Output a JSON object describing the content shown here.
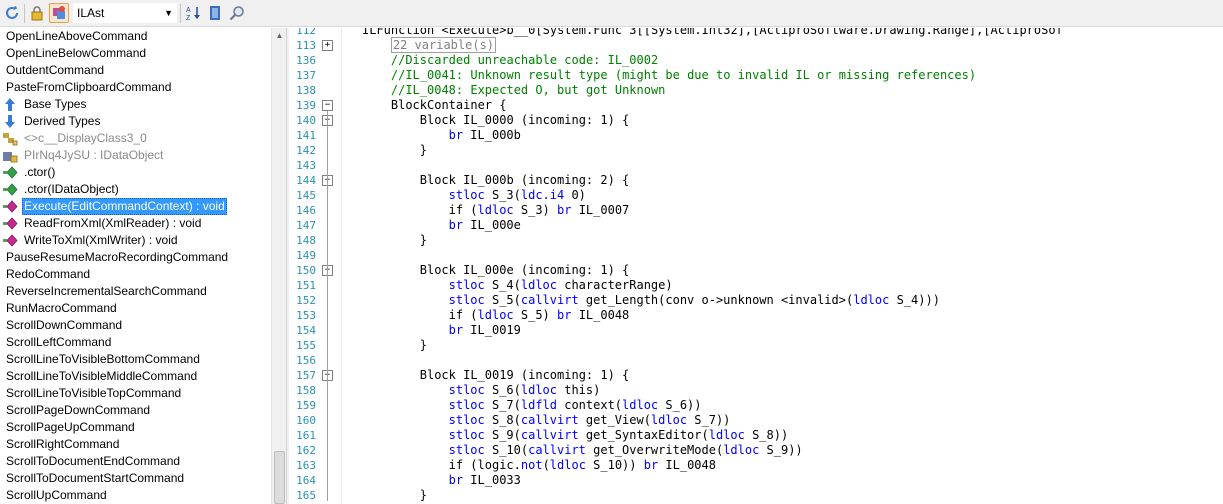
{
  "toolbar": {
    "language": "ILAst"
  },
  "tree": {
    "items": [
      {
        "label": "OpenLineAboveCommand",
        "icon": "",
        "indent": 0,
        "style": "normal"
      },
      {
        "label": "OpenLineBelowCommand",
        "icon": "",
        "indent": 0,
        "style": "normal"
      },
      {
        "label": "OutdentCommand",
        "icon": "",
        "indent": 0,
        "style": "normal"
      },
      {
        "label": "PasteFromClipboardCommand",
        "icon": "",
        "indent": 0,
        "style": "normal"
      },
      {
        "label": "Base Types",
        "icon": "base-types-icon",
        "indent": 1,
        "style": "normal"
      },
      {
        "label": "Derived Types",
        "icon": "derived-types-icon",
        "indent": 1,
        "style": "normal"
      },
      {
        "label": "<>c__DisplayClass3_0",
        "icon": "nested-class-icon",
        "indent": 1,
        "style": "grey"
      },
      {
        "label": "PIrNq4JySU : IDataObject",
        "icon": "private-property-icon",
        "indent": 1,
        "style": "grey"
      },
      {
        "label": ".ctor()",
        "icon": "method-icon",
        "indent": 1,
        "style": "normal"
      },
      {
        "label": ".ctor(IDataObject)",
        "icon": "method-icon",
        "indent": 1,
        "style": "normal"
      },
      {
        "label": "Execute(EditCommandContext) : void",
        "icon": "override-method-icon",
        "indent": 1,
        "style": "selected"
      },
      {
        "label": "ReadFromXml(XmlReader) : void",
        "icon": "override-method-icon",
        "indent": 1,
        "style": "normal"
      },
      {
        "label": "WriteToXml(XmlWriter) : void",
        "icon": "override-method-icon",
        "indent": 1,
        "style": "normal"
      },
      {
        "label": "PauseResumeMacroRecordingCommand",
        "icon": "",
        "indent": 0,
        "style": "normal"
      },
      {
        "label": "RedoCommand",
        "icon": "",
        "indent": 0,
        "style": "normal"
      },
      {
        "label": "ReverseIncrementalSearchCommand",
        "icon": "",
        "indent": 0,
        "style": "normal"
      },
      {
        "label": "RunMacroCommand",
        "icon": "",
        "indent": 0,
        "style": "normal"
      },
      {
        "label": "ScrollDownCommand",
        "icon": "",
        "indent": 0,
        "style": "normal"
      },
      {
        "label": "ScrollLeftCommand",
        "icon": "",
        "indent": 0,
        "style": "normal"
      },
      {
        "label": "ScrollLineToVisibleBottomCommand",
        "icon": "",
        "indent": 0,
        "style": "normal"
      },
      {
        "label": "ScrollLineToVisibleMiddleCommand",
        "icon": "",
        "indent": 0,
        "style": "normal"
      },
      {
        "label": "ScrollLineToVisibleTopCommand",
        "icon": "",
        "indent": 0,
        "style": "normal"
      },
      {
        "label": "ScrollPageDownCommand",
        "icon": "",
        "indent": 0,
        "style": "normal"
      },
      {
        "label": "ScrollPageUpCommand",
        "icon": "",
        "indent": 0,
        "style": "normal"
      },
      {
        "label": "ScrollRightCommand",
        "icon": "",
        "indent": 0,
        "style": "normal"
      },
      {
        "label": "ScrollToDocumentEndCommand",
        "icon": "",
        "indent": 0,
        "style": "normal"
      },
      {
        "label": "ScrollToDocumentStartCommand",
        "icon": "",
        "indent": 0,
        "style": "normal"
      },
      {
        "label": "ScrollUpCommand",
        "icon": "",
        "indent": 0,
        "style": "normal"
      }
    ]
  },
  "code": {
    "lines": [
      {
        "num": "112",
        "indent": 0,
        "fold": "",
        "segments": [
          {
            "t": "ILFunction <Execute>b__0[System.Func`3[[System.Int32],[ActiproSoftware.Drawing.Range],[ActiproSof",
            "c": "n"
          }
        ]
      },
      {
        "num": "113",
        "indent": 4,
        "fold": "+",
        "segments": [
          {
            "t": "22 variable(s)",
            "c": "box"
          }
        ]
      },
      {
        "num": "136",
        "indent": 4,
        "fold": "",
        "segments": [
          {
            "t": "//Discarded unreachable code: IL_0002",
            "c": "cm"
          }
        ]
      },
      {
        "num": "137",
        "indent": 4,
        "fold": "",
        "segments": [
          {
            "t": "//IL_0041: Unknown result type (might be due to invalid IL or missing references)",
            "c": "cm"
          }
        ]
      },
      {
        "num": "138",
        "indent": 4,
        "fold": "",
        "segments": [
          {
            "t": "//IL_0048: Expected O, but got Unknown",
            "c": "cm"
          }
        ]
      },
      {
        "num": "139",
        "indent": 4,
        "fold": "-",
        "segments": [
          {
            "t": "BlockContainer {",
            "c": "n"
          }
        ]
      },
      {
        "num": "140",
        "indent": 8,
        "fold": "-",
        "segments": [
          {
            "t": "Block IL_0000 (incoming: 1) {",
            "c": "n"
          }
        ]
      },
      {
        "num": "141",
        "indent": 12,
        "fold": "",
        "segments": [
          {
            "t": "br",
            "c": "kw"
          },
          {
            "t": " IL_000b",
            "c": "n"
          }
        ]
      },
      {
        "num": "142",
        "indent": 8,
        "fold": "",
        "segments": [
          {
            "t": "}",
            "c": "n"
          }
        ]
      },
      {
        "num": "143",
        "indent": 0,
        "fold": "",
        "segments": []
      },
      {
        "num": "144",
        "indent": 8,
        "fold": "-",
        "segments": [
          {
            "t": "Block IL_000b (incoming: 2) {",
            "c": "n"
          }
        ]
      },
      {
        "num": "145",
        "indent": 12,
        "fold": "",
        "segments": [
          {
            "t": "stloc",
            "c": "kw"
          },
          {
            "t": " S_3(",
            "c": "n"
          },
          {
            "t": "ldc.i4",
            "c": "kw"
          },
          {
            "t": " 0)",
            "c": "n"
          }
        ]
      },
      {
        "num": "146",
        "indent": 12,
        "fold": "",
        "segments": [
          {
            "t": "if (",
            "c": "n"
          },
          {
            "t": "ldloc",
            "c": "kw"
          },
          {
            "t": " S_3) ",
            "c": "n"
          },
          {
            "t": "br",
            "c": "kw"
          },
          {
            "t": " IL_0007",
            "c": "n"
          }
        ]
      },
      {
        "num": "147",
        "indent": 12,
        "fold": "",
        "segments": [
          {
            "t": "br",
            "c": "kw"
          },
          {
            "t": " IL_000e",
            "c": "n"
          }
        ]
      },
      {
        "num": "148",
        "indent": 8,
        "fold": "",
        "segments": [
          {
            "t": "}",
            "c": "n"
          }
        ]
      },
      {
        "num": "149",
        "indent": 0,
        "fold": "",
        "segments": []
      },
      {
        "num": "150",
        "indent": 8,
        "fold": "-",
        "segments": [
          {
            "t": "Block IL_000e (incoming: 1) {",
            "c": "n"
          }
        ]
      },
      {
        "num": "151",
        "indent": 12,
        "fold": "",
        "segments": [
          {
            "t": "stloc",
            "c": "kw"
          },
          {
            "t": " S_4(",
            "c": "n"
          },
          {
            "t": "ldloc",
            "c": "kw"
          },
          {
            "t": " characterRange)",
            "c": "n"
          }
        ]
      },
      {
        "num": "152",
        "indent": 12,
        "fold": "",
        "segments": [
          {
            "t": "stloc",
            "c": "kw"
          },
          {
            "t": " S_5(",
            "c": "n"
          },
          {
            "t": "callvirt",
            "c": "kw"
          },
          {
            "t": " get_Length(conv o->unknown <invalid>(",
            "c": "n"
          },
          {
            "t": "ldloc",
            "c": "kw"
          },
          {
            "t": " S_4)))",
            "c": "n"
          }
        ]
      },
      {
        "num": "153",
        "indent": 12,
        "fold": "",
        "segments": [
          {
            "t": "if (",
            "c": "n"
          },
          {
            "t": "ldloc",
            "c": "kw"
          },
          {
            "t": " S_5) ",
            "c": "n"
          },
          {
            "t": "br",
            "c": "kw"
          },
          {
            "t": " IL_0048",
            "c": "n"
          }
        ]
      },
      {
        "num": "154",
        "indent": 12,
        "fold": "",
        "segments": [
          {
            "t": "br",
            "c": "kw"
          },
          {
            "t": " IL_0019",
            "c": "n"
          }
        ]
      },
      {
        "num": "155",
        "indent": 8,
        "fold": "",
        "segments": [
          {
            "t": "}",
            "c": "n"
          }
        ]
      },
      {
        "num": "156",
        "indent": 0,
        "fold": "",
        "segments": []
      },
      {
        "num": "157",
        "indent": 8,
        "fold": "-",
        "segments": [
          {
            "t": "Block IL_0019 (incoming: 1) {",
            "c": "n"
          }
        ]
      },
      {
        "num": "158",
        "indent": 12,
        "fold": "",
        "segments": [
          {
            "t": "stloc",
            "c": "kw"
          },
          {
            "t": " S_6(",
            "c": "n"
          },
          {
            "t": "ldloc",
            "c": "kw"
          },
          {
            "t": " this)",
            "c": "n"
          }
        ]
      },
      {
        "num": "159",
        "indent": 12,
        "fold": "",
        "segments": [
          {
            "t": "stloc",
            "c": "kw"
          },
          {
            "t": " S_7(",
            "c": "n"
          },
          {
            "t": "ldfld",
            "c": "kw"
          },
          {
            "t": " context(",
            "c": "n"
          },
          {
            "t": "ldloc",
            "c": "kw"
          },
          {
            "t": " S_6))",
            "c": "n"
          }
        ]
      },
      {
        "num": "160",
        "indent": 12,
        "fold": "",
        "segments": [
          {
            "t": "stloc",
            "c": "kw"
          },
          {
            "t": " S_8(",
            "c": "n"
          },
          {
            "t": "callvirt",
            "c": "kw"
          },
          {
            "t": " get_View(",
            "c": "n"
          },
          {
            "t": "ldloc",
            "c": "kw"
          },
          {
            "t": " S_7))",
            "c": "n"
          }
        ]
      },
      {
        "num": "161",
        "indent": 12,
        "fold": "",
        "segments": [
          {
            "t": "stloc",
            "c": "kw"
          },
          {
            "t": " S_9(",
            "c": "n"
          },
          {
            "t": "callvirt",
            "c": "kw"
          },
          {
            "t": " get_SyntaxEditor(",
            "c": "n"
          },
          {
            "t": "ldloc",
            "c": "kw"
          },
          {
            "t": " S_8))",
            "c": "n"
          }
        ]
      },
      {
        "num": "162",
        "indent": 12,
        "fold": "",
        "segments": [
          {
            "t": "stloc",
            "c": "kw"
          },
          {
            "t": " S_10(",
            "c": "n"
          },
          {
            "t": "callvirt",
            "c": "kw"
          },
          {
            "t": " get_OverwriteMode(",
            "c": "n"
          },
          {
            "t": "ldloc",
            "c": "kw"
          },
          {
            "t": " S_9))",
            "c": "n"
          }
        ]
      },
      {
        "num": "163",
        "indent": 12,
        "fold": "",
        "segments": [
          {
            "t": "if (logic.",
            "c": "n"
          },
          {
            "t": "not",
            "c": "kw"
          },
          {
            "t": "(",
            "c": "n"
          },
          {
            "t": "ldloc",
            "c": "kw"
          },
          {
            "t": " S_10)) ",
            "c": "n"
          },
          {
            "t": "br",
            "c": "kw"
          },
          {
            "t": " IL_0048",
            "c": "n"
          }
        ]
      },
      {
        "num": "164",
        "indent": 12,
        "fold": "",
        "segments": [
          {
            "t": "br",
            "c": "kw"
          },
          {
            "t": " IL_0033",
            "c": "n"
          }
        ]
      },
      {
        "num": "165",
        "indent": 8,
        "fold": "",
        "segments": [
          {
            "t": "}",
            "c": "n"
          }
        ]
      }
    ]
  },
  "colors": {
    "keyword": "#0000ff",
    "comment": "#008000",
    "line_number": "#2b91af",
    "selection": "#3399ff"
  }
}
